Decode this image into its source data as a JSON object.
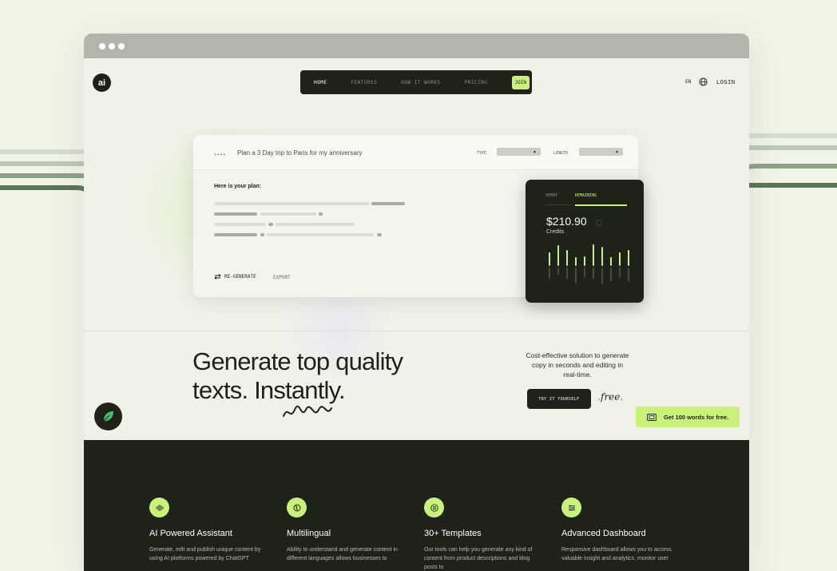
{
  "nav": {
    "items": [
      {
        "label": "HOME"
      },
      {
        "label": "FEATURES"
      },
      {
        "label": "HOW IT WORKS"
      },
      {
        "label": "PRICING"
      }
    ],
    "join_label": "JOIN",
    "lang": "EN",
    "login_label": "LOGIN"
  },
  "brand": {
    "logo_text": "ai"
  },
  "card": {
    "prompt": "Plan a 3 Day trip to Paris for my anniversary",
    "type_label": "TYPE",
    "length_label": "LENGTH",
    "plan_title": "Here is your plan:",
    "regenerate_label": "RE-GENERATE",
    "export_label": "EXPORT"
  },
  "credits": {
    "tab_spent": "SPENT",
    "tab_remaining": "REMAINING",
    "amount": "$210.90",
    "label": "Credits",
    "bars": [
      {
        "up": 0.55,
        "down": 0.55
      },
      {
        "up": 0.85,
        "down": 0.35
      },
      {
        "up": 0.65,
        "down": 0.55
      },
      {
        "up": 0.35,
        "down": 0.75
      },
      {
        "up": 0.4,
        "down": 0.45
      },
      {
        "up": 0.9,
        "down": 0.55
      },
      {
        "up": 0.8,
        "down": 0.8
      },
      {
        "up": 0.35,
        "down": 0.65
      },
      {
        "up": 0.55,
        "down": 0.45
      },
      {
        "up": 0.65,
        "down": 0.7
      }
    ]
  },
  "hero": {
    "headline_line1": "Generate top quality",
    "headline_line2": "texts. Instantly.",
    "cost_text": "Cost-effective solution to generate copy in seconds and editing in real-time.",
    "try_label": "TRY IT YOURSELF",
    "free_text": "free",
    "get_words_label": "Get 100 words for free."
  },
  "features": [
    {
      "title": "AI Powered Assistant",
      "desc": "Generate, edit and publish unique content by using AI platforms powered by ChatGPT",
      "icon": "waveform-icon"
    },
    {
      "title": "Multilingual",
      "desc": "Ability to understand and generate content in different languages allows businesses to",
      "icon": "globe-icon"
    },
    {
      "title": "30+ Templates",
      "desc": "Our tools can help you generate any kind of content from product descriptions and blog posts to",
      "icon": "menu-icon"
    },
    {
      "title": "Advanced Dashboard",
      "desc": "Responsive dashboard allows you to access valuable insight and analytics, monitor user",
      "icon": "sliders-icon"
    }
  ],
  "colors": {
    "accent": "#c9f27a",
    "dark": "#1f2219",
    "background": "#f2f1e9"
  }
}
